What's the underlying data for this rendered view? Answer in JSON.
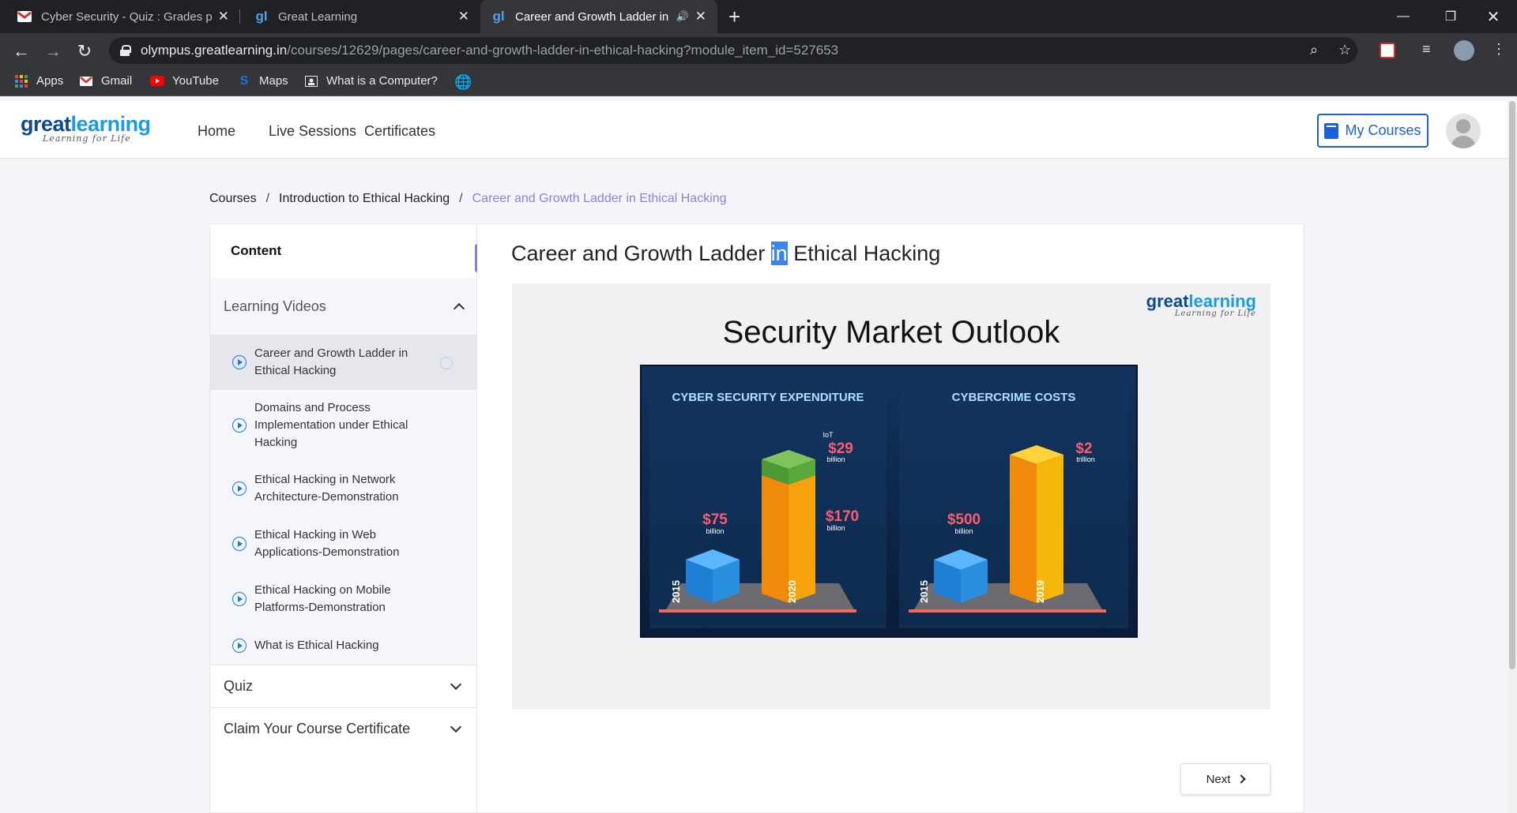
{
  "browser": {
    "tabs": [
      {
        "title": "Cyber Security - Quiz : Grades pu",
        "icon": "gmail-icon"
      },
      {
        "title": "Great Learning",
        "icon": "greatlearning-icon"
      },
      {
        "title": "Career and Growth Ladder in",
        "icon": "greatlearning-icon",
        "active": true
      }
    ],
    "url_host": "olympus.greatlearning.in",
    "url_path": "/courses/12629/pages/career-and-growth-ladder-in-ethical-hacking?module_item_id=527653",
    "bookmarks": [
      {
        "label": "Apps",
        "icon": "apps-grid-icon"
      },
      {
        "label": "Gmail",
        "icon": "gmail-icon"
      },
      {
        "label": "YouTube",
        "icon": "youtube-icon"
      },
      {
        "label": "Maps",
        "icon": "maps-icon"
      },
      {
        "label": "What is a Computer?",
        "icon": "page-icon"
      }
    ]
  },
  "site": {
    "logo_a": "great",
    "logo_b": "learning",
    "logo_tagline": "Learning for Life",
    "nav": [
      "Home",
      "Live Sessions",
      "Certificates"
    ],
    "my_courses": "My Courses"
  },
  "breadcrumb": {
    "items": [
      "Courses",
      "Introduction to Ethical Hacking"
    ],
    "current": "Career and Growth Ladder in Ethical Hacking",
    "separator": "/"
  },
  "sidebar": {
    "title": "Content",
    "sections": [
      {
        "label": "Learning Videos",
        "expanded": true
      },
      {
        "label": "Quiz",
        "expanded": false
      },
      {
        "label": "Claim Your Course Certificate",
        "expanded": false
      }
    ],
    "lessons": [
      "Career and Growth Ladder in Ethical Hacking",
      "Domains and Process Implementation under Ethical Hacking",
      "Ethical Hacking in Network Architecture-Demonstration",
      "Ethical Hacking in Web Applications-Demonstration",
      "Ethical Hacking on Mobile Platforms-Demonstration",
      "What is Ethical Hacking"
    ],
    "collapse_icon": "«"
  },
  "page": {
    "title_before": "Career and Growth Ladder ",
    "title_highlight": "in",
    "title_after": " Ethical Hacking",
    "next_label": "Next"
  },
  "slide": {
    "heading": "Security Market Outlook",
    "logo_a": "great",
    "logo_b": "learning",
    "logo_tagline": "Learning for Life",
    "panels": [
      {
        "title": "CYBER SECURITY EXPENDITURE",
        "bars": [
          {
            "year": "2015",
            "value": "$75",
            "unit": "billion",
            "color": "#2b8fe0"
          },
          {
            "year": "2020",
            "value": "$170",
            "unit": "billion",
            "color": "#f5a20c",
            "extra_label": "IoT",
            "extra_value": "$29",
            "extra_unit": "billion",
            "extra_color": "#5aa83c"
          }
        ]
      },
      {
        "title": "CYBERCRIME COSTS",
        "bars": [
          {
            "year": "2015",
            "value": "$500",
            "unit": "billion",
            "color": "#2b8fe0"
          },
          {
            "year": "2019",
            "value": "$2",
            "unit": "trillion",
            "color": "#f5a20c"
          }
        ]
      }
    ]
  }
}
